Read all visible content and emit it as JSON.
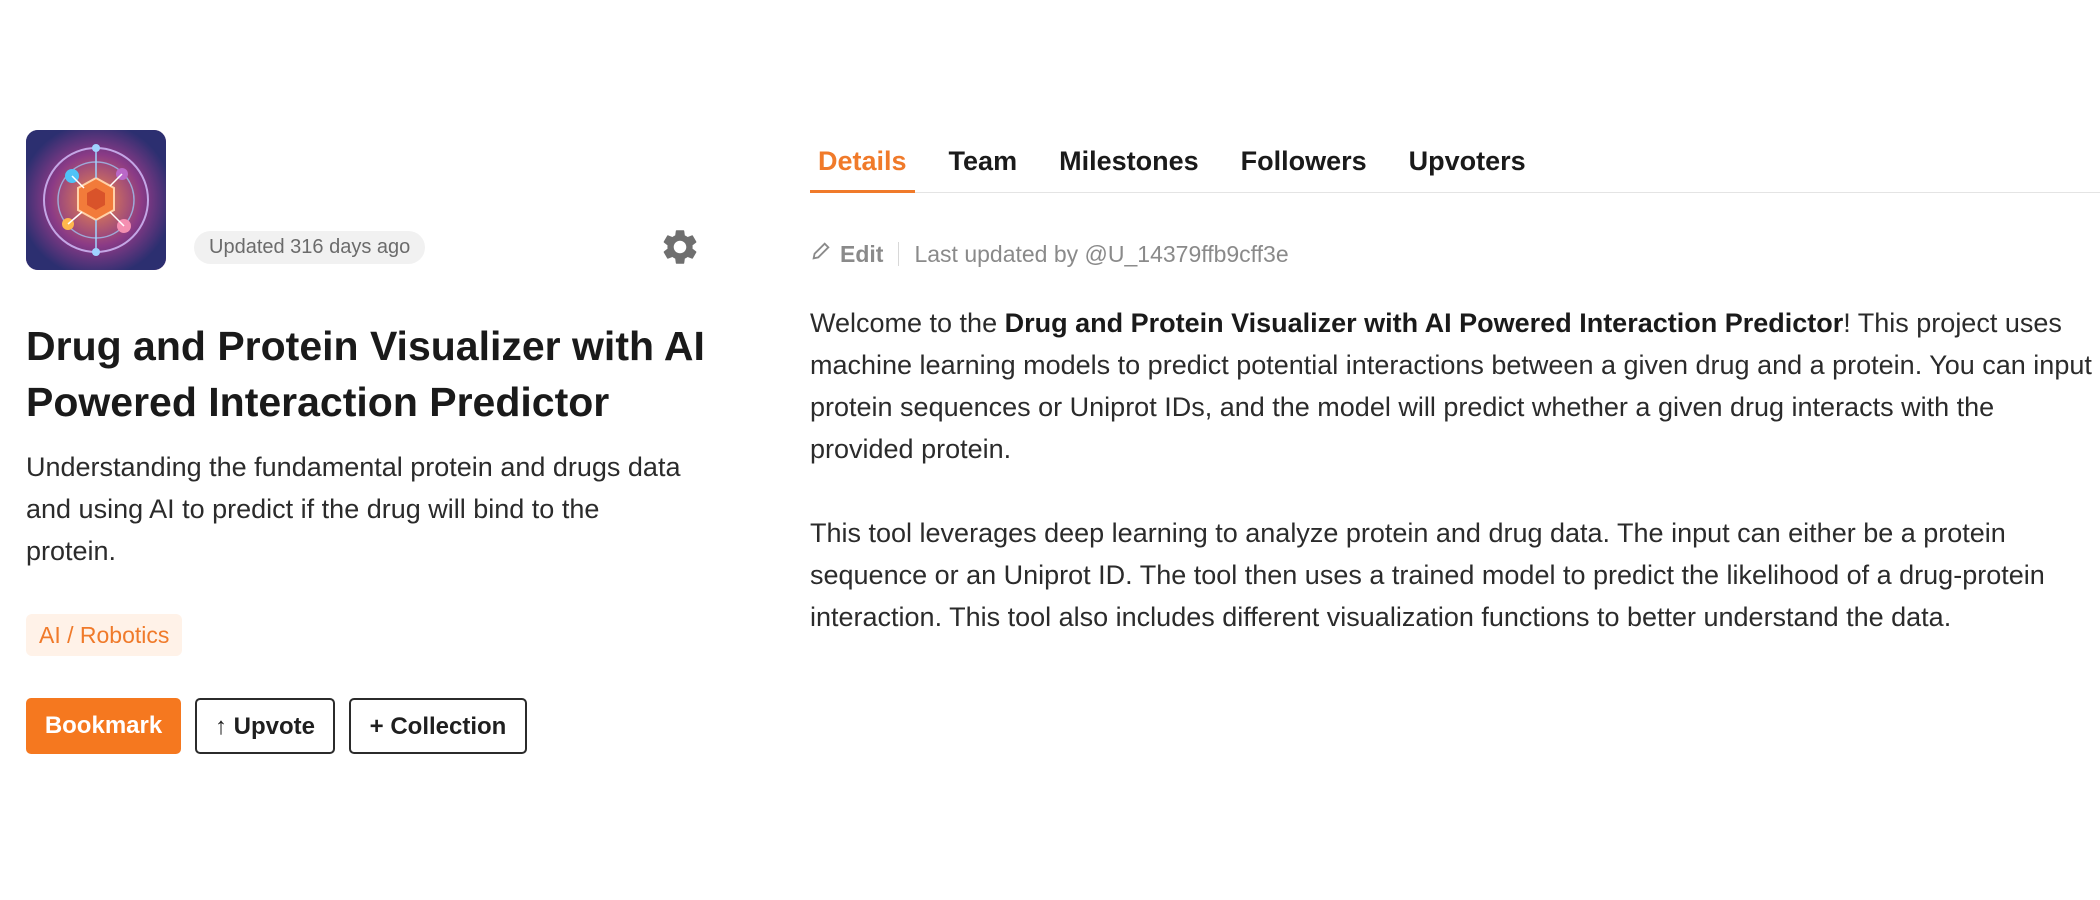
{
  "project": {
    "updated_badge": "Updated 316 days ago",
    "title": "Drug and Protein Visualizer with AI Powered Interaction Predictor",
    "subtitle": "Understanding the fundamental protein and drugs data and using AI to predict if the drug will bind to the protein.",
    "tag": "AI / Robotics",
    "icons": {
      "settings": "gear-icon",
      "edit": "pencil-icon"
    }
  },
  "actions": {
    "bookmark": "Bookmark",
    "upvote": "↑ Upvote",
    "collection": "+ Collection"
  },
  "tabs": [
    {
      "label": "Details",
      "active": true
    },
    {
      "label": "Team",
      "active": false
    },
    {
      "label": "Milestones",
      "active": false
    },
    {
      "label": "Followers",
      "active": false
    },
    {
      "label": "Upvoters",
      "active": false
    }
  ],
  "details": {
    "edit_label": "Edit",
    "last_updated": "Last updated by @U_14379ffb9cff3e",
    "para1_prefix": "Welcome to the ",
    "para1_bold": "Drug and Protein Visualizer with AI Powered Interaction Predictor",
    "para1_suffix": "! This project uses machine learning models to predict potential interactions between a given drug and a protein. You can input protein sequences or Uniprot IDs, and the model will predict whether a given drug interacts with the provided protein.",
    "para2": "This tool leverages deep learning to analyze protein and drug data. The input can either be a protein sequence or an Uniprot ID. The tool then uses a trained model to predict the likelihood of a drug-protein interaction. This tool also includes different visualization functions to better understand the data."
  },
  "colors": {
    "accent": "#f5781f",
    "tag_bg": "#fff2e8",
    "muted": "#8a8a8a"
  }
}
